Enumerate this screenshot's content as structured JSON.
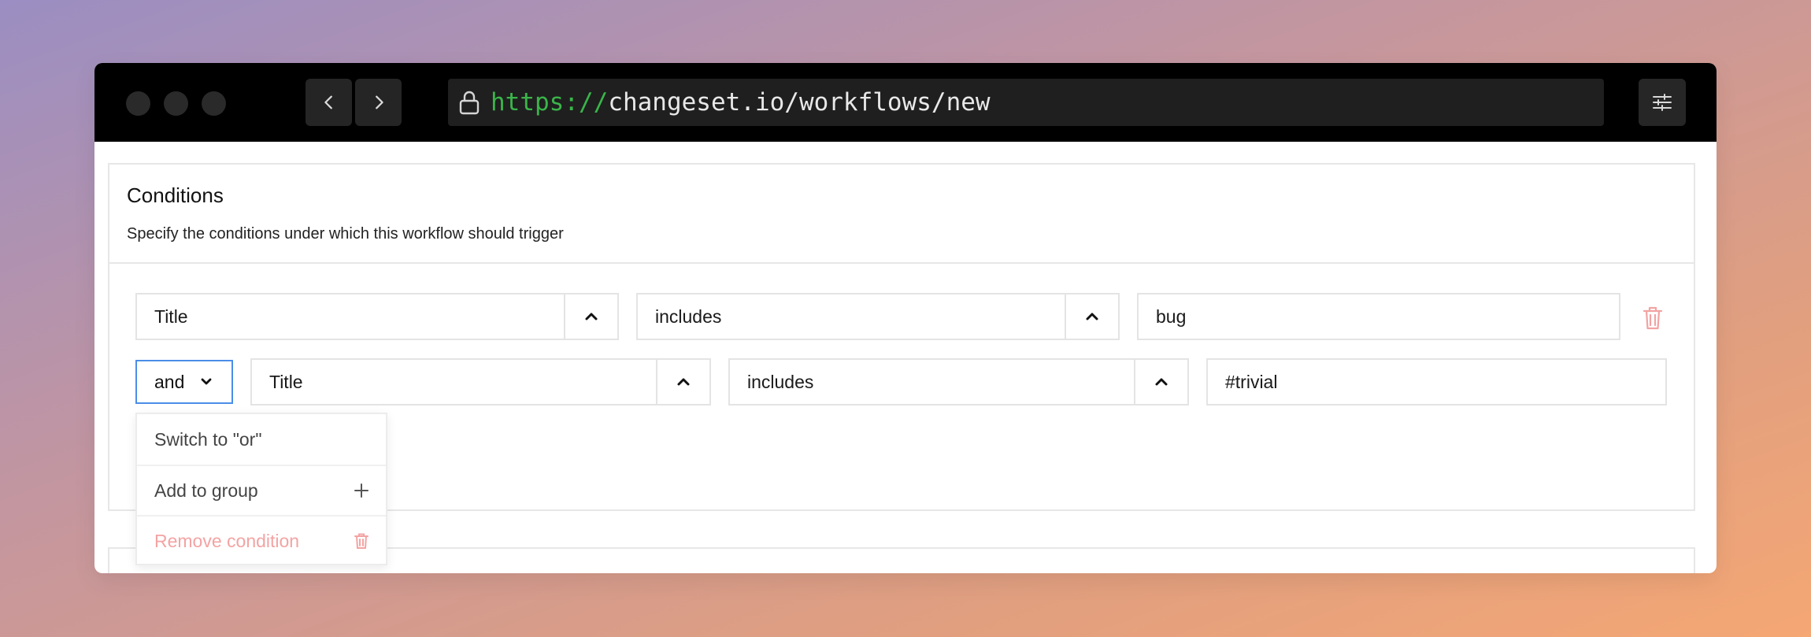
{
  "browser": {
    "url_scheme": "https://",
    "url_rest": "changeset.io/workflows/new"
  },
  "conditions": {
    "title": "Conditions",
    "subtitle": "Specify the conditions under which this workflow should trigger",
    "rows": [
      {
        "field": "Title",
        "operator": "includes",
        "value": "bug"
      },
      {
        "connector": "and",
        "field": "Title",
        "operator": "includes",
        "value": "#trivial"
      }
    ]
  },
  "connector_menu": {
    "items": [
      {
        "label": "Switch to \"or\"",
        "icon": ""
      },
      {
        "label": "Add to group",
        "icon": "plus-icon"
      },
      {
        "label": "Remove condition",
        "icon": "trash-icon"
      }
    ]
  },
  "colors": {
    "url_scheme": "#3ab54a",
    "danger": "#f4a3a3",
    "focus": "#4a8ee8"
  }
}
